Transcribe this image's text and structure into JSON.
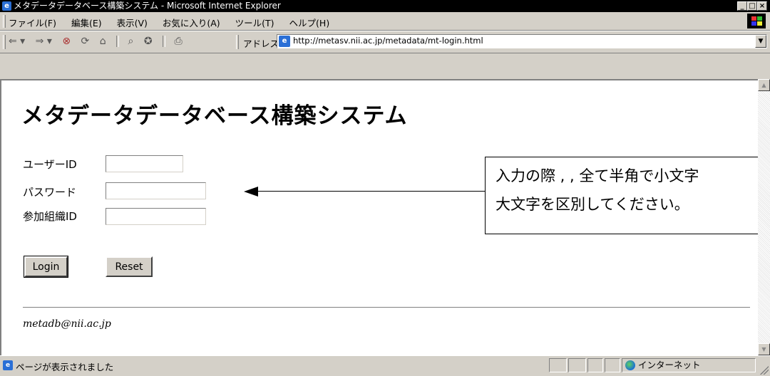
{
  "window": {
    "title": "メタデータデータベース構築システム - Microsoft Internet Explorer"
  },
  "menu": {
    "items": [
      "ファイル(F)",
      "編集(E)",
      "表示(V)",
      "お気に入り(A)",
      "ツール(T)",
      "ヘルプ(H)"
    ]
  },
  "toolbar": {
    "address_label": "アドレス(D)",
    "url": "http://metasv.nii.ac.jp/metadata/mt-login.html"
  },
  "page": {
    "title": "メタデータデータベース構築システム",
    "user_id_label": "ユーザーID",
    "password_label": "パスワード",
    "org_id_label": "参加組織ID",
    "user_id_value": "",
    "password_value": "",
    "org_id_value": "",
    "login_label": "Login",
    "reset_label": "Reset",
    "contact_email": "metadb@nii.ac.jp"
  },
  "callout": {
    "line1": "入力の際 , , 全て半角で小文字",
    "line2": "大文字を区別してください。"
  },
  "status": {
    "text": "ページが表示されました",
    "zone": "インターネット"
  },
  "icons": {
    "app": "ie-icon",
    "back": "back-arrow-icon",
    "forward": "forward-arrow-icon",
    "stop": "stop-icon",
    "refresh": "refresh-icon",
    "home": "home-icon",
    "search": "search-icon",
    "favorites": "favorites-icon",
    "print": "print-icon",
    "windows_logo": "windows-logo-icon",
    "globe": "globe-icon"
  },
  "colors": {
    "chrome": "#d4d0c8",
    "titlebar": "#000000",
    "content_bg": "#ffffff"
  }
}
